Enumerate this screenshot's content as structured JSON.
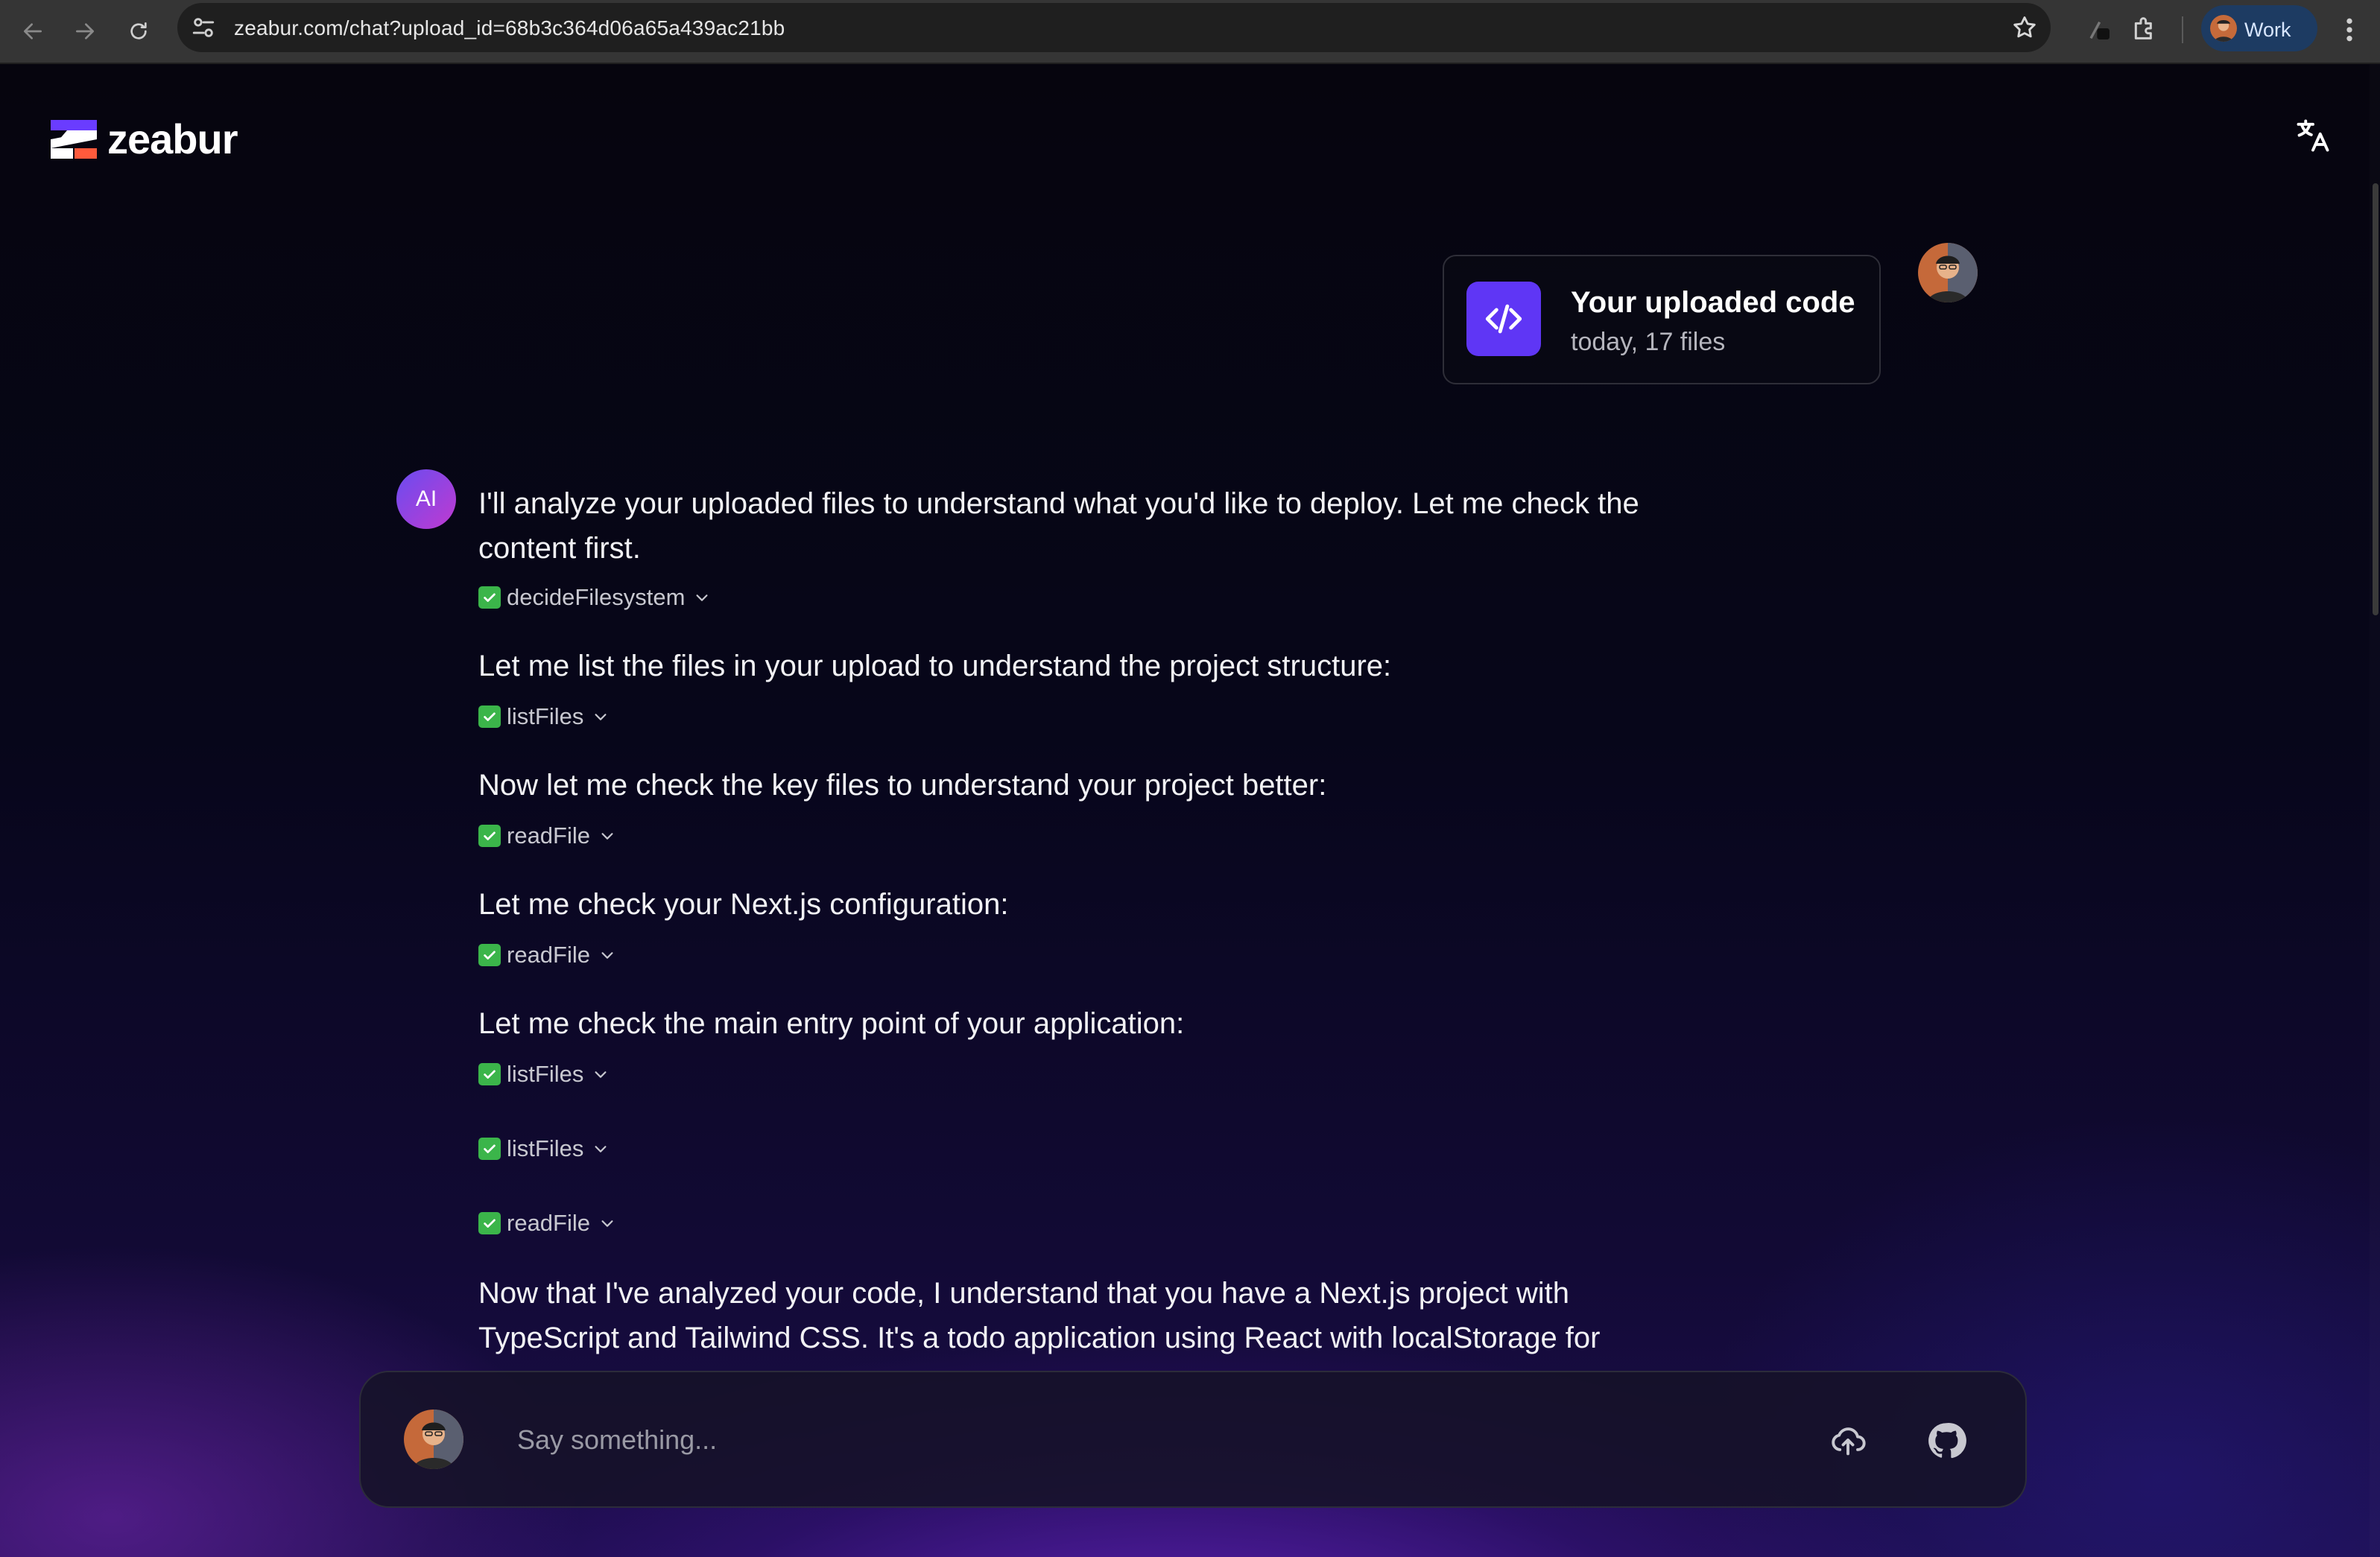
{
  "browser": {
    "url": "zeabur.com/chat?upload_id=68b3c364d06a65a439ac21bb",
    "profile_label": "Work"
  },
  "header": {
    "brand": "zeabur",
    "translate_icon": "translate-icon"
  },
  "upload_card": {
    "title": "Your uploaded code",
    "subtitle": "today, 17 files"
  },
  "ai": {
    "avatar_label": "AI"
  },
  "conversation": [
    {
      "type": "text",
      "lines": [
        "I'll analyze your uploaded files to understand what you'd like to deploy. Let me check the",
        "content first."
      ]
    },
    {
      "type": "tool",
      "name": "decideFilesystem"
    },
    {
      "type": "text",
      "lines": [
        "Let me list the files in your upload to understand the project structure:"
      ]
    },
    {
      "type": "tool",
      "name": "listFiles"
    },
    {
      "type": "text",
      "lines": [
        "Now let me check the key files to understand your project better:"
      ]
    },
    {
      "type": "tool",
      "name": "readFile"
    },
    {
      "type": "text",
      "lines": [
        "Let me check your Next.js configuration:"
      ]
    },
    {
      "type": "tool",
      "name": "readFile"
    },
    {
      "type": "text",
      "lines": [
        "Let me check the main entry point of your application:"
      ]
    },
    {
      "type": "tool",
      "name": "listFiles"
    },
    {
      "type": "tool",
      "name": "listFiles"
    },
    {
      "type": "tool",
      "name": "readFile"
    },
    {
      "type": "text",
      "lines": [
        "Now that I've analyzed your code, I understand that you have a Next.js project with",
        "TypeScript and Tailwind CSS. It's a todo application using React with localStorage for"
      ]
    }
  ],
  "composer": {
    "placeholder": "Say something..."
  },
  "colors": {
    "accent": "#5f36f5",
    "check": "#3bb54a",
    "background": "#05040d"
  }
}
